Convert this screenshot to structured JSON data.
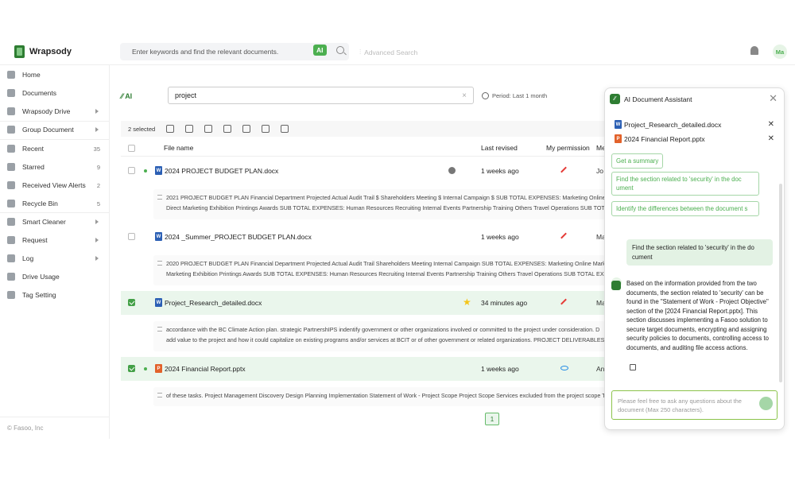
{
  "app": {
    "name": "Wrapsody"
  },
  "topbar": {
    "search_placeholder": "Enter keywords and find the relevant documents.",
    "ai_badge": "AI",
    "advanced_search": "Advanced Search",
    "user_initials": "Ma"
  },
  "sidebar": {
    "items": [
      {
        "label": "Home",
        "icon": "home-icon"
      },
      {
        "label": "Documents",
        "icon": "document-icon"
      },
      {
        "label": "Wrapsody Drive",
        "icon": "drive-icon"
      },
      {
        "label": "Group Document",
        "icon": "group-document-icon"
      },
      {
        "label": "Recent",
        "icon": "recent-icon",
        "count": "35"
      },
      {
        "label": "Starred",
        "icon": "star-icon",
        "count": "9"
      },
      {
        "label": "Received View Alerts",
        "icon": "alert-icon",
        "count": "2"
      },
      {
        "label": "Recycle Bin",
        "icon": "trash-icon",
        "count": "5"
      },
      {
        "label": "Smart Cleaner",
        "icon": "cleaner-icon"
      },
      {
        "label": "Request",
        "icon": "request-icon"
      },
      {
        "label": "Log",
        "icon": "log-icon"
      },
      {
        "label": "Drive Usage",
        "icon": "chart-icon"
      },
      {
        "label": "Tag Setting",
        "icon": "tag-icon"
      }
    ],
    "footer": "© Fasoo, Inc"
  },
  "main": {
    "ai_label": "AI",
    "query": "project",
    "period": "Period: Last 1 month",
    "selected_count": "2 selected",
    "columns": {
      "name": "File name",
      "revised": "Last revised",
      "permission": "My permission",
      "owner": "Me"
    },
    "rows": [
      {
        "name": "2024 PROJECT BUDGET PLAN.docx",
        "revised": "1 weeks ago",
        "owner": "Jo",
        "type": "word",
        "checked": false,
        "permission": "edit",
        "snippet1": "2021 PROJECT BUDGET PLAN Financial Department Projected Actual Audit Trail $ Shareholders Meeting $ Internal Campaign $ SUB TOTAL EXPENSES: Marketing Online Market",
        "snippet2": "Direct Marketing Exhibition Printings Awards SUB TOTAL EXPENSES: Human Resources Recruiting Internal Events Partnership Training Others Travel Operations SUB TOTAL E"
      },
      {
        "name": "2024 _Summer_PROJECT BUDGET PLAN.docx",
        "revised": "1 weeks ago",
        "owner": "Ma",
        "type": "word",
        "checked": false,
        "permission": "edit",
        "snippet1": "2020 PROJECT BUDGET PLAN Financial Department Projected Actual Audit Trail Shareholders Meeting Internal Campaign SUB TOTAL EXPENSES: Marketing Online Marketing",
        "snippet2": "Marketing Exhibition Printings Awards SUB TOTAL EXPENSES: Human Resources Recruiting Internal Events Partnership Training Others Travel Operations SUB TOTAL EXPENSE"
      },
      {
        "name": "Project_Research_detailed.docx",
        "revised": "34 minutes ago",
        "owner": "Ma",
        "type": "word",
        "checked": true,
        "permission": "edit",
        "snippet1": "accordance with the BC Climate Action plan. strategic PartnershIPS indentify government or other organizations involved or committed to the project under consideration. D",
        "snippet2": "add value to the project and how it could capitalize on existing programs and/or services at BCIT or of other government or related organizations. PROJECT DELIVERABLES De"
      },
      {
        "name": "2024 Financial Report.pptx",
        "revised": "1 weeks ago",
        "owner": "An",
        "type": "ppt",
        "checked": true,
        "permission": "view",
        "snippet1": "of these tasks. Project Management Discovery Design Planning Implementation Statement of Work - Project Scope Project Scope Services excluded from the project scope Th"
      }
    ],
    "page": "1"
  },
  "assistant": {
    "title": "AI Document Assistant",
    "files": [
      {
        "name": "Project_Research_detailed.docx",
        "type": "word"
      },
      {
        "name": "2024 Financial Report.pptx",
        "type": "ppt"
      }
    ],
    "suggestions": [
      "Get a summary",
      "Find the section related to 'security' in the doc ument",
      "Identify the differences between the document s"
    ],
    "user_initials": "Ma",
    "user_message": "Find the section related to 'security' in the do cument",
    "bot_message": "Based on the information provided from the two documents, the section related to 'security' can be found in the \"Statement of Work - Project Objective\" section of the [2024 Financial Report.pptx]. This section discusses implementing a Fasoo solution to secure target documents, encrypting and assigning security policies to documents, controlling access to documents, and auditing file access actions.",
    "input_placeholder": "Please feel free to ask any questions about the document (Max 250 characters)."
  }
}
